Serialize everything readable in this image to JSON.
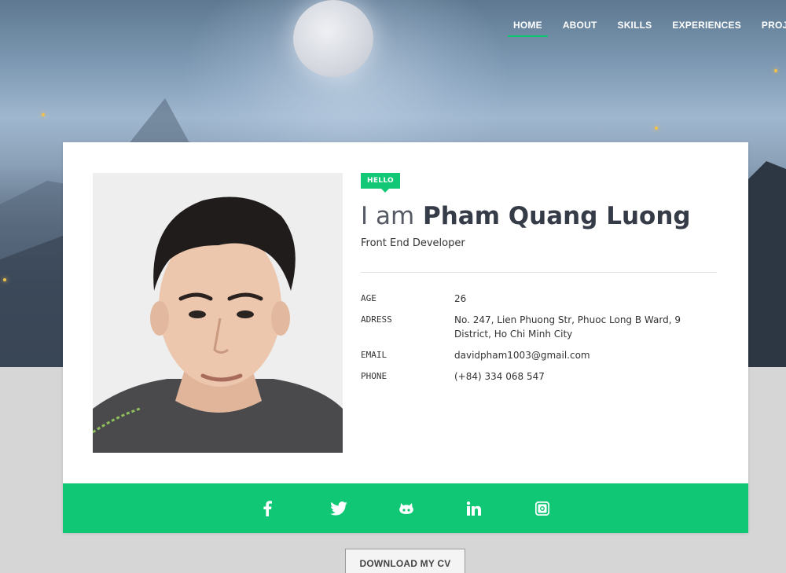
{
  "nav": {
    "items": [
      {
        "label": "HOME",
        "active": true
      },
      {
        "label": "ABOUT",
        "active": false
      },
      {
        "label": "SKILLS",
        "active": false
      },
      {
        "label": "EXPERIENCES",
        "active": false
      },
      {
        "label": "PROJECTS",
        "active": false
      }
    ]
  },
  "profile": {
    "badge": "HELLO",
    "lead": "I am",
    "name": "Pham Quang Luong",
    "role": "Front End Developer",
    "details": [
      {
        "label": "AGE",
        "value": "26"
      },
      {
        "label": "ADRESS",
        "value": "No. 247, Lien Phuong Str, Phuoc Long B Ward, 9 District, Ho Chi Minh City"
      },
      {
        "label": "EMAIL",
        "value": "davidpham1003@gmail.com"
      },
      {
        "label": "PHONE",
        "value": "(+84) 334 068 547"
      }
    ]
  },
  "social": {
    "icons": [
      "facebook-icon",
      "twitter-icon",
      "github-icon",
      "linkedin-icon",
      "instagram-icon"
    ]
  },
  "actions": {
    "download_label": "DOWNLOAD MY CV"
  },
  "colors": {
    "accent": "#0fc774",
    "text": "#363b48",
    "page_bg": "#d6d6d6"
  }
}
